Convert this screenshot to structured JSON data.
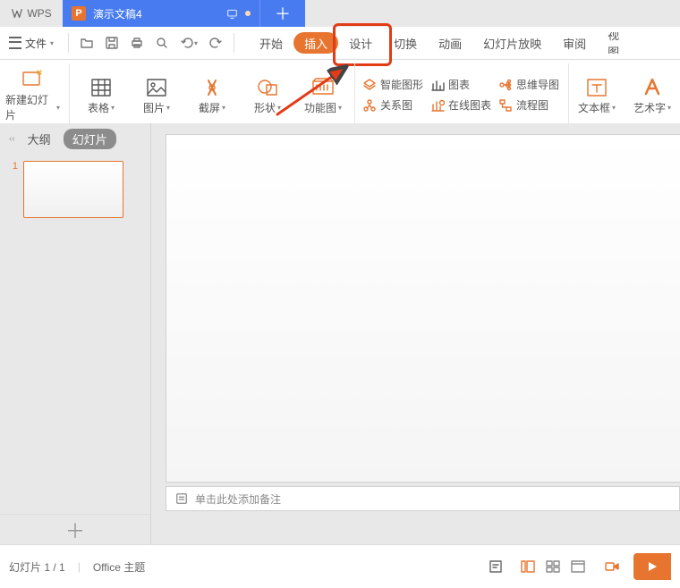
{
  "app": {
    "name": "WPS"
  },
  "doc": {
    "icon": "P",
    "title": "演示文稿4"
  },
  "file_menu": "文件",
  "tabs": {
    "start": "开始",
    "insert": "插入",
    "design": "设计",
    "transition": "切换",
    "animation": "动画",
    "slideshow": "幻灯片放映",
    "review": "审阅",
    "view": "视图"
  },
  "ribbon": {
    "new_slide": "新建幻灯片",
    "table": "表格",
    "picture": "图片",
    "screenshot": "截屏",
    "shape": "形状",
    "func": "功能图",
    "smart": "智能图形",
    "chart": "图表",
    "relation": "关系图",
    "online_chart": "在线图表",
    "mindmap": "思维导图",
    "flow": "流程图",
    "textbox": "文本框",
    "wordart": "艺术字"
  },
  "sidepanel": {
    "outline": "大纲",
    "slides": "幻灯片",
    "thumbs": [
      {
        "n": "1"
      }
    ]
  },
  "notes_placeholder": "单击此处添加备注",
  "status": {
    "counter": "幻灯片 1 / 1",
    "theme": "Office 主题"
  }
}
